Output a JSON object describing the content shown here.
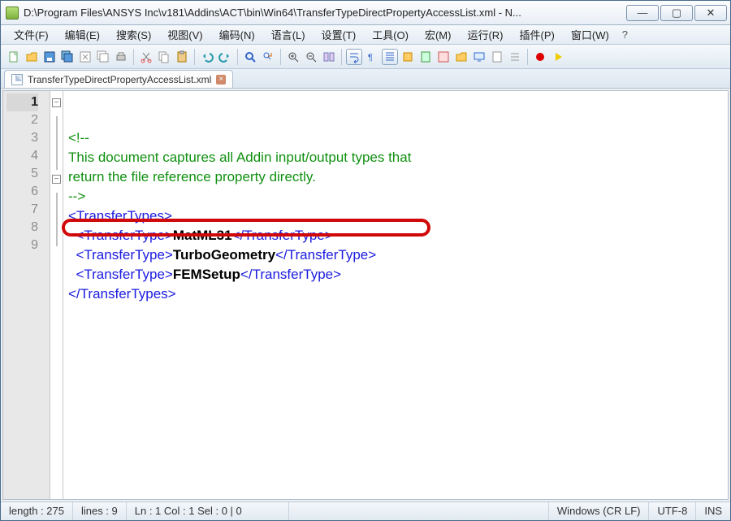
{
  "title": "D:\\Program Files\\ANSYS Inc\\v181\\Addins\\ACT\\bin\\Win64\\TransferTypeDirectPropertyAccessList.xml - N...",
  "menus": [
    "文件(F)",
    "编辑(E)",
    "搜索(S)",
    "视图(V)",
    "编码(N)",
    "语言(L)",
    "设置(T)",
    "工具(O)",
    "宏(M)",
    "运行(R)",
    "插件(P)",
    "窗口(W)"
  ],
  "menu_more": "?",
  "tab": {
    "label": "TransferTypeDirectPropertyAccessList.xml",
    "close": "×"
  },
  "toolbar_icons": [
    "file-new",
    "folder-open",
    "save",
    "save-all",
    "copy-all",
    "close",
    "close-all",
    "print",
    "cut",
    "copy",
    "paste",
    "undo",
    "redo",
    "find",
    "replace",
    "zoom-in",
    "zoom-out",
    "sync",
    "word-wrap",
    "show-all",
    "indent-guide",
    "lang",
    "folder",
    "doc1",
    "doc2",
    "monitor",
    "doc3",
    "page",
    "list",
    "record",
    "play"
  ],
  "code": {
    "c1": "<!--",
    "c2": "This document captures all Addin input/output types that",
    "c3": "return the file reference property directly.",
    "c4": "-->",
    "open_root": "<TransferTypes>",
    "close_root": "</TransferTypes>",
    "open_tt": "<TransferType>",
    "close_tt": "</TransferType>",
    "v1": "MatML31",
    "v2": "TurboGeometry",
    "v3": "FEMSetup"
  },
  "lines": [
    "1",
    "2",
    "3",
    "4",
    "5",
    "6",
    "7",
    "8",
    "9"
  ],
  "status": {
    "length": "length : 275",
    "lines": "lines : 9",
    "pos": "Ln : 1    Col : 1    Sel : 0 | 0",
    "eol": "Windows (CR LF)",
    "enc": "UTF-8",
    "ins": "INS"
  },
  "win_btns": {
    "min": "—",
    "max": "▢",
    "close": "✕"
  }
}
